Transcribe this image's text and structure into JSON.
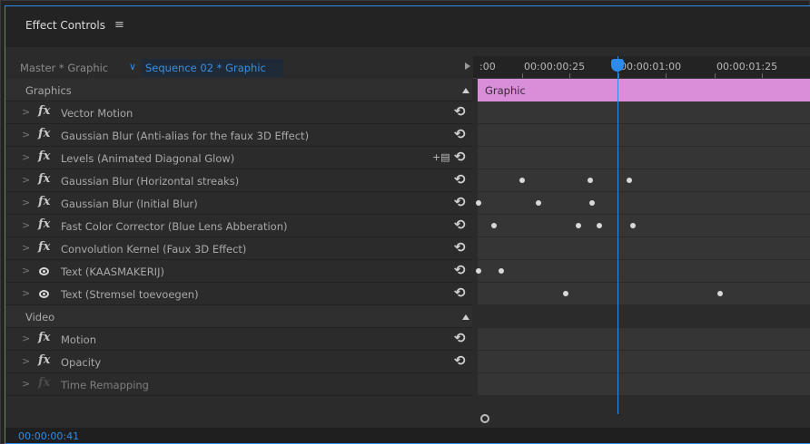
{
  "panel": {
    "title": "Effect Controls",
    "menu_icon": "hamburger-icon",
    "menu_glyph": "≡"
  },
  "header": {
    "master": "Master * Graphic",
    "sequence": "Sequence 02 * Graphic"
  },
  "ruler": {
    "labels": [
      ":00",
      "00:00:00:25",
      "00:00:01:00",
      "00:00:01:25"
    ]
  },
  "clip": {
    "name": "Graphic"
  },
  "sections": {
    "graphics": "Graphics",
    "video": "Video"
  },
  "effects": [
    {
      "label": "Vector Motion",
      "icon": "fx-icon"
    },
    {
      "label": "Gaussian Blur (Anti-alias for the faux 3D Effect)",
      "icon": "fx-icon"
    },
    {
      "label": "Levels (Animated Diagonal Glow)",
      "icon": "fx-icon"
    },
    {
      "label": "Gaussian Blur (Horizontal streaks)",
      "icon": "fx-icon"
    },
    {
      "label": "Gaussian Blur (Initial Blur)",
      "icon": "fx-icon"
    },
    {
      "label": "Fast Color Corrector (Blue Lens Abberation)",
      "icon": "fx-icon"
    },
    {
      "label": "Convolution Kernel (Faux 3D Effect)",
      "icon": "fx-icon"
    },
    {
      "label": "Text (KAASMAKERIJ)",
      "icon": "eye-icon"
    },
    {
      "label": "Text (Stremsel toevoegen)",
      "icon": "eye-icon"
    }
  ],
  "video_effects": [
    {
      "label": "Motion",
      "icon": "fx-icon"
    },
    {
      "label": "Opacity",
      "icon": "fx-icon"
    },
    {
      "label": "Time Remapping",
      "icon": "fx-icon"
    }
  ],
  "fx_glyph": "fx",
  "reset_glyph": "⟲",
  "chevron_glyph": ">",
  "mask_glyph": "+▤",
  "footer": {
    "timecode": "00:00:00:41"
  },
  "colors": {
    "accent": "#2d8ceb",
    "clip": "#d88ed8"
  }
}
